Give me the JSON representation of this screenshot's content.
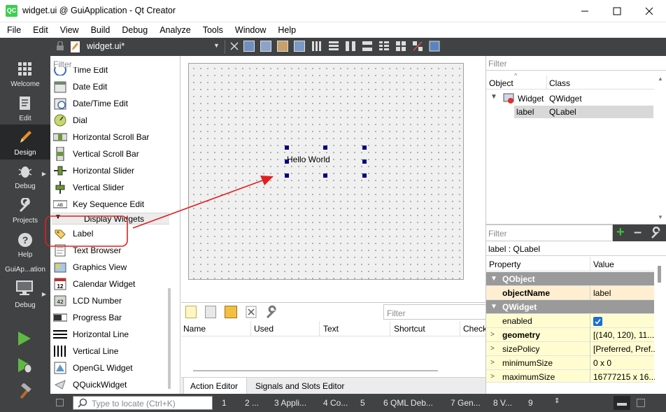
{
  "window": {
    "logo": "QC",
    "title": "widget.ui @ GuiApplication - Qt Creator"
  },
  "menu": [
    "File",
    "Edit",
    "View",
    "Build",
    "Debug",
    "Analyze",
    "Tools",
    "Window",
    "Help"
  ],
  "modes": {
    "welcome": "Welcome",
    "edit": "Edit",
    "design": "Design",
    "debug": "Debug",
    "projects": "Projects",
    "help": "Help",
    "kit_name": "GuiAp...ation",
    "kit_mode": "Debug"
  },
  "editor": {
    "filename": "widget.ui*"
  },
  "palette": {
    "filter_placeholder": "Filter",
    "items_top": [
      "Time Edit",
      "Date Edit",
      "Date/Time Edit",
      "Dial",
      "Horizontal Scroll Bar",
      "Vertical Scroll Bar",
      "Horizontal Slider",
      "Vertical Slider",
      "Key Sequence Edit"
    ],
    "category": "Display Widgets",
    "items_display": [
      "Label",
      "Text Browser",
      "Graphics View",
      "Calendar Widget",
      "LCD Number",
      "Progress Bar",
      "Horizontal Line",
      "Vertical Line",
      "OpenGL Widget",
      "QQuickWidget"
    ]
  },
  "form": {
    "label_text": "Hello World"
  },
  "action_editor": {
    "filter_placeholder": "Filter",
    "columns": [
      "Name",
      "Used",
      "Text",
      "Shortcut",
      "Check"
    ],
    "tabs": [
      "Action Editor",
      "Signals and Slots Editor"
    ]
  },
  "object_inspector": {
    "filter_placeholder": "Filter",
    "col_object": "Object",
    "col_class": "Class",
    "rows": [
      {
        "object": "Widget",
        "class": "QWidget"
      },
      {
        "object": "label",
        "class": "QLabel"
      }
    ]
  },
  "property_editor": {
    "filter_placeholder": "Filter",
    "context": "label : QLabel",
    "col_property": "Property",
    "col_value": "Value",
    "group_qobject": "QObject",
    "objectName_label": "objectName",
    "objectName_value": "label",
    "group_qwidget": "QWidget",
    "enabled_label": "enabled",
    "geometry_label": "geometry",
    "geometry_value": "[(140, 120), 11...",
    "sizePolicy_label": "sizePolicy",
    "sizePolicy_value": "[Preferred, Pref...",
    "minimumSize_label": "minimumSize",
    "minimumSize_value": "0 x 0",
    "maximumSize_label": "maximumSize",
    "maximumSize_value": "16777215 x 16..."
  },
  "statusbar": {
    "locator_placeholder": "Type to locate (Ctrl+K)",
    "panes": [
      "1",
      "2 ...",
      "3 Appli...",
      "4 Co...",
      "5",
      "6 QML Deb...",
      "7 Gen...",
      "8 V...",
      "9"
    ]
  },
  "colors": {
    "annotation": "#e02020",
    "handles": "#000080",
    "modebar": "#404244"
  }
}
